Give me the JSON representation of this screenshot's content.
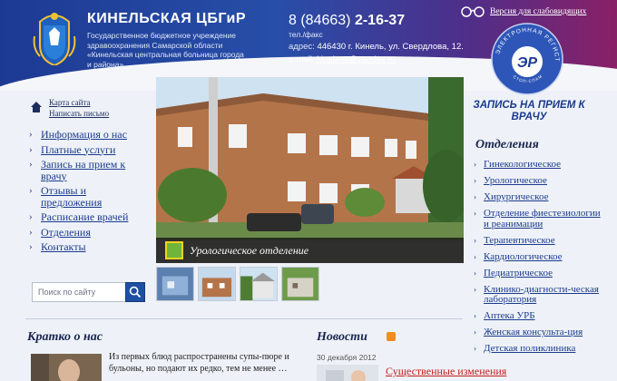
{
  "header": {
    "org_name": "КИНЕЛЬСКАЯ ЦБГиР",
    "org_full_name": "Государственное бюджетное учреждение здравоохранения Самарской области «Кинельская центральная больница города и района»",
    "phone_prefix": "8 (84663)",
    "phone_number": "2-16-37",
    "phone_label": "тел./факс",
    "address_label": "адрес:",
    "address": "446430 г. Кинель, ул. Свердлова, 12.",
    "email_label": "e-mail:",
    "email": "kineltmo@yandex.ru",
    "low_vision_link": "Версия для слабовидящих",
    "badge_text": "ЭЛЕКТРОННАЯ РЕГИСТРАТУРА",
    "badge_logo": "ЭР",
    "badge_subtext": "СТОП-СПАМ"
  },
  "top_links": {
    "sitemap": "Карта сайта",
    "write_letter": "Написать письмо"
  },
  "nav": {
    "items": [
      "Информация о нас",
      "Платные услуги",
      "Запись на прием к врачу",
      "Отзывы и предложения",
      "Расписание врачей",
      "Отделения",
      "Контакты"
    ]
  },
  "search": {
    "placeholder": "Поиск по сайту"
  },
  "slider": {
    "caption": "Урологическое отделение"
  },
  "appointment": {
    "label": "ЗАПИСЬ НА ПРИЕМ К ВРАЧУ"
  },
  "departments": {
    "title": "Отделения",
    "items": [
      "Гинекологическое",
      "Урологическое",
      "Хирургическое",
      "Отделение фиестезиологии и реанимации",
      "Терапевтическое",
      "Кардиологическое",
      "Педиатрическое",
      "Клинико-диагности-ческая лаборатория",
      "Аптека УРБ",
      "Женская консульта-ция",
      "Детская поликлиника"
    ]
  },
  "brief": {
    "title": "Кратко о нас",
    "text": "Из первых блюд распространены супы-пюре и бульоны, но подают их редко, тем не менее …"
  },
  "news": {
    "title": "Новости",
    "date": "30 декабря 2012",
    "headline": "Существенные изменения"
  },
  "colors": {
    "header_blue": "#1d3a93",
    "header_magenta": "#8a2066",
    "link_blue": "#1a3a8c",
    "news_red": "#c51c1c"
  }
}
